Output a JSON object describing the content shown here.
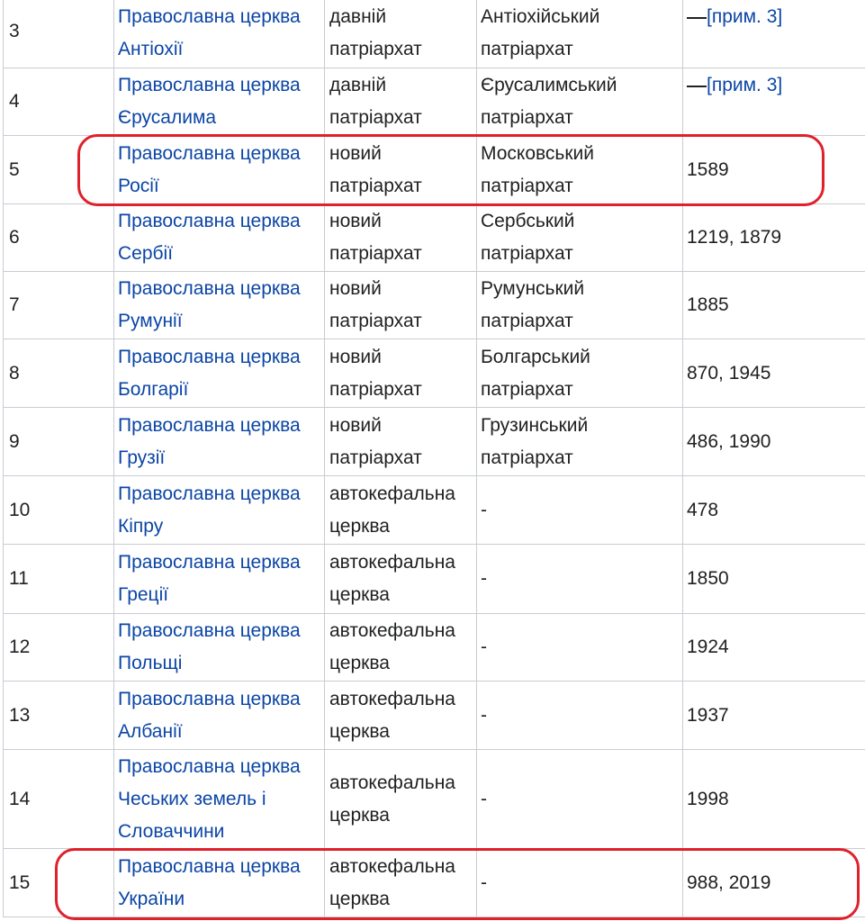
{
  "table": {
    "rows": [
      {
        "num": "3",
        "church_line1": "Православна церква",
        "church_line2": "Антіохії",
        "type_line1": "давній",
        "type_line2": "патріархат",
        "status_line1": "Антіохійський",
        "status_line2": "патріархат",
        "year": "",
        "note": "[прим. 3]"
      },
      {
        "num": "4",
        "church_line1": "Православна церква",
        "church_line2": "Єрусалима",
        "type_line1": "давній",
        "type_line2": "патріархат",
        "status_line1": "Єрусалимський",
        "status_line2": "патріархат",
        "year": "",
        "note": "[прим. 3]"
      },
      {
        "num": "5",
        "church_line1": "Православна церква",
        "church_line2": "Росії",
        "type_line1": "новий",
        "type_line2": "патріархат",
        "status_line1": "Московський",
        "status_line2": "патріархат",
        "year": "1589"
      },
      {
        "num": "6",
        "church_line1": "Православна церква",
        "church_line2": "Сербії",
        "type_line1": "новий",
        "type_line2": "патріархат",
        "status_line1": "Сербський",
        "status_line2": "патріархат",
        "year": "1219, 1879"
      },
      {
        "num": "7",
        "church_line1": "Православна церква",
        "church_line2": "Румунії",
        "type_line1": "новий",
        "type_line2": "патріархат",
        "status_line1": "Румунський",
        "status_line2": "патріархат",
        "year": "1885"
      },
      {
        "num": "8",
        "church_line1": "Православна церква",
        "church_line2": "Болгарії",
        "type_line1": "новий",
        "type_line2": "патріархат",
        "status_line1": "Болгарський",
        "status_line2": "патріархат",
        "year": "870, 1945"
      },
      {
        "num": "9",
        "church_line1": "Православна церква",
        "church_line2": "Грузії",
        "type_line1": "новий",
        "type_line2": "патріархат",
        "status_line1": "Грузинський",
        "status_line2": "патріархат",
        "year": "486, 1990"
      },
      {
        "num": "10",
        "church_line1": "Православна церква",
        "church_line2": "Кіпру",
        "type_line1": "автокефальна",
        "type_line2": "церква",
        "status_line1": "-",
        "status_line2": "",
        "year": "478"
      },
      {
        "num": "11",
        "church_line1": "Православна церква",
        "church_line2": "Греції",
        "type_line1": "автокефальна",
        "type_line2": "церква",
        "status_line1": "-",
        "status_line2": "",
        "year": "1850"
      },
      {
        "num": "12",
        "church_line1": "Православна церква",
        "church_line2": "Польщі",
        "type_line1": "автокефальна",
        "type_line2": "церква",
        "status_line1": "-",
        "status_line2": "",
        "year": "1924"
      },
      {
        "num": "13",
        "church_line1": "Православна церква",
        "church_line2": "Албанії",
        "type_line1": "автокефальна",
        "type_line2": "церква",
        "status_line1": "-",
        "status_line2": "",
        "year": "1937"
      },
      {
        "num": "14",
        "church_line1": "Православна церква",
        "church_line2": "Чеських земель і",
        "church_line3": "Словаччини",
        "type_line1": "автокефальна",
        "type_line2": "церква",
        "status_line1": "-",
        "status_line2": "",
        "year": "1998"
      },
      {
        "num": "15",
        "church_line1": "Православна церква",
        "church_line2": "України",
        "type_line1": "автокефальна",
        "type_line2": "церква",
        "status_line1": "-",
        "status_line2": "",
        "year": "988, 2019"
      }
    ]
  },
  "colors": {
    "link": "#0b45a6",
    "highlight": "#e0202b",
    "border": "#c8ccd1"
  }
}
